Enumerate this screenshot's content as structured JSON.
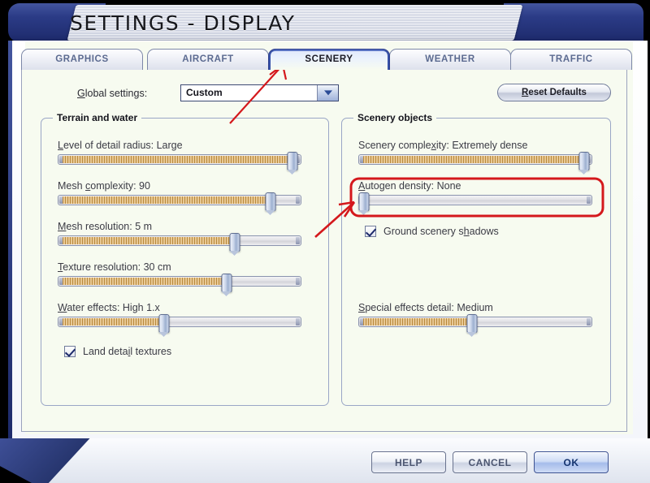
{
  "window": {
    "title": "SETTINGS - DISPLAY"
  },
  "tabs": [
    {
      "id": "graphics",
      "label": "GRAPHICS",
      "active": false
    },
    {
      "id": "aircraft",
      "label": "AIRCRAFT",
      "active": false
    },
    {
      "id": "scenery",
      "label": "SCENERY",
      "active": true
    },
    {
      "id": "weather",
      "label": "WEATHER",
      "active": false
    },
    {
      "id": "traffic",
      "label": "TRAFFIC",
      "active": false
    }
  ],
  "global_settings": {
    "label": "Global settings:",
    "label_accesskey": "G",
    "selected_value": "Custom",
    "options": [
      "Custom"
    ]
  },
  "reset_button": {
    "label": "Reset Defaults",
    "accesskey": "R"
  },
  "groups": {
    "terrain": {
      "title": "Terrain and water",
      "settings": [
        {
          "name": "level-of-detail-radius",
          "label": "Level of detail radius: Large",
          "accesskey": "L",
          "value": "Large",
          "fill_percent": 97
        },
        {
          "name": "mesh-complexity",
          "label": "Mesh complexity: 90",
          "accesskey": "c",
          "value": "90",
          "fill_percent": 88
        },
        {
          "name": "mesh-resolution",
          "label": "Mesh resolution: 5 m",
          "accesskey": "M",
          "value": "5 m",
          "fill_percent": 73
        },
        {
          "name": "texture-resolution",
          "label": "Texture resolution: 30 cm",
          "accesskey": "T",
          "value": "30 cm",
          "fill_percent": 70
        },
        {
          "name": "water-effects",
          "label": "Water effects: High 1.x",
          "accesskey": "W",
          "value": "High 1.x",
          "fill_percent": 43
        }
      ],
      "checkbox": {
        "name": "land-detail-textures",
        "label": "Land detail textures",
        "accesskey": "i",
        "checked": true
      }
    },
    "scenery": {
      "title": "Scenery objects",
      "settings": [
        {
          "name": "scenery-complexity",
          "label": "Scenery complexity: Extremely dense",
          "accesskey": "x",
          "value": "Extremely dense",
          "fill_percent": 98
        },
        {
          "name": "autogen-density",
          "label": "Autogen density: None",
          "accesskey": "A",
          "value": "None",
          "fill_percent": 0
        },
        {
          "name": "special-effects-detail",
          "label": "Special effects detail: Medium",
          "accesskey": "S",
          "value": "Medium",
          "fill_percent": 48
        }
      ],
      "checkbox": {
        "name": "ground-scenery-shadows",
        "label": "Ground scenery shadows",
        "accesskey": "h",
        "checked": true
      }
    }
  },
  "footer_buttons": [
    {
      "id": "help",
      "label": "HELP",
      "style": "light"
    },
    {
      "id": "cancel",
      "label": "CANCEL",
      "style": "light"
    },
    {
      "id": "ok",
      "label": "OK",
      "style": "primary"
    }
  ],
  "annotations": {
    "color": "#d4181c",
    "arrow_to_scenery_tab": "arrow pointing up-right to the SCENERY tab",
    "arrow_to_autogen": "arrow pointing up-right to the Autogen density slider",
    "highlight_box": "red rectangle around the Autogen density setting"
  },
  "colors": {
    "chrome_navy": "#2b3b86",
    "panel_bg": "#f7fbf0",
    "slider_fill": "#d3a85e",
    "annotation_red": "#d4181c",
    "tab_text": "#5b6a90"
  }
}
